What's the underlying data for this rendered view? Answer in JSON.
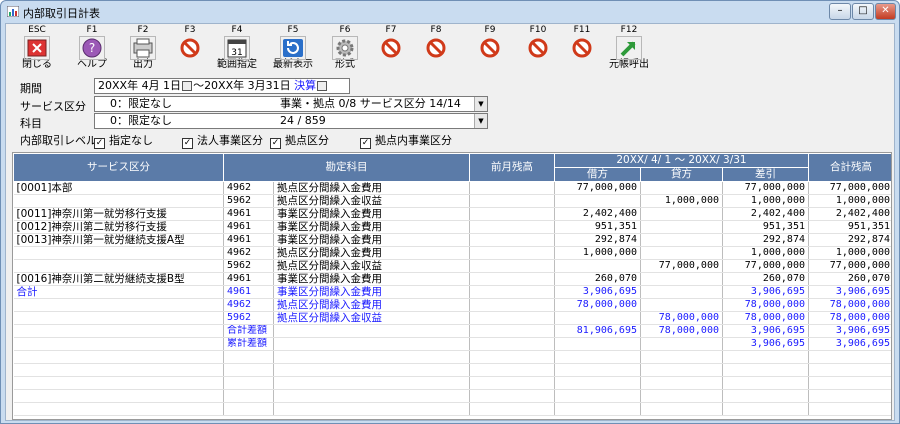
{
  "window": {
    "title": "内部取引日計表",
    "buttons": {
      "minimize": "–",
      "maximize": "□",
      "close": "✕"
    }
  },
  "toolbar": [
    {
      "key": "ESC",
      "label": "閉じる",
      "icon": "close-door-icon"
    },
    {
      "key": "F1",
      "label": "ヘルプ",
      "icon": "help-icon"
    },
    {
      "key": "F2",
      "label": "出力",
      "icon": "output-icon"
    },
    {
      "key": "F3",
      "label": "",
      "icon": "disabled-icon"
    },
    {
      "key": "F4",
      "label": "範囲指定",
      "icon": "calendar-icon"
    },
    {
      "key": "F5",
      "label": "最新表示",
      "icon": "refresh-icon"
    },
    {
      "key": "F6",
      "label": "形式",
      "icon": "gear-icon"
    },
    {
      "key": "F7",
      "label": "",
      "icon": "disabled-icon"
    },
    {
      "key": "F8",
      "label": "",
      "icon": "disabled-icon"
    },
    {
      "key": "F9",
      "label": "",
      "icon": "disabled-icon"
    },
    {
      "key": "F10",
      "label": "",
      "icon": "disabled-icon"
    },
    {
      "key": "F11",
      "label": "",
      "icon": "disabled-icon"
    },
    {
      "key": "F12",
      "label": "元帳呼出",
      "icon": "ledger-arrow-icon"
    }
  ],
  "form": {
    "period_label": "期間",
    "period_start": "20XX年 4月 1日",
    "period_sep": "～",
    "period_end": "20XX年 3月31日",
    "period_settle": "決算",
    "service_label": "サービス区分",
    "service_value": "0：限定なし",
    "service_summary": "事業・拠点 0/8  サービス区分 14/14",
    "subject_label": "科目",
    "subject_value": "0：限定なし",
    "subject_summary": "24 / 859",
    "level_label": "内部取引レベル",
    "checks": [
      {
        "label": "指定なし",
        "checked": true
      },
      {
        "label": "法人事業区分",
        "checked": true
      },
      {
        "label": "拠点区分",
        "checked": true
      },
      {
        "label": "拠点内事業区分",
        "checked": true
      }
    ]
  },
  "grid": {
    "headers": {
      "service": "サービス区分",
      "account": "勘定科目",
      "prev": "前月残高",
      "period": "20XX/ 4/ 1 ～ 20XX/ 3/31",
      "debit": "借方",
      "credit": "貸方",
      "diff": "差引",
      "total": "合計残高"
    },
    "rows": [
      {
        "service": "[0001]本部",
        "code": "4962",
        "account": "拠点区分間繰入金費用",
        "prev": "",
        "debit": "77,000,000",
        "credit": "",
        "diff": "77,000,000",
        "total": "77,000,000",
        "blue": false
      },
      {
        "service": "",
        "code": "5962",
        "account": "拠点区分間繰入金収益",
        "prev": "",
        "debit": "",
        "credit": "1,000,000",
        "diff": "1,000,000",
        "total": "1,000,000",
        "blue": false
      },
      {
        "service": "[0011]神奈川第一就労移行支援",
        "code": "4961",
        "account": "事業区分間繰入金費用",
        "prev": "",
        "debit": "2,402,400",
        "credit": "",
        "diff": "2,402,400",
        "total": "2,402,400",
        "blue": false
      },
      {
        "service": "[0012]神奈川第二就労移行支援",
        "code": "4961",
        "account": "事業区分間繰入金費用",
        "prev": "",
        "debit": "951,351",
        "credit": "",
        "diff": "951,351",
        "total": "951,351",
        "blue": false
      },
      {
        "service": "[0013]神奈川第一就労継続支援A型",
        "code": "4961",
        "account": "事業区分間繰入金費用",
        "prev": "",
        "debit": "292,874",
        "credit": "",
        "diff": "292,874",
        "total": "292,874",
        "blue": false
      },
      {
        "service": "",
        "code": "4962",
        "account": "拠点区分間繰入金費用",
        "prev": "",
        "debit": "1,000,000",
        "credit": "",
        "diff": "1,000,000",
        "total": "1,000,000",
        "blue": false
      },
      {
        "service": "",
        "code": "5962",
        "account": "拠点区分間繰入金収益",
        "prev": "",
        "debit": "",
        "credit": "77,000,000",
        "diff": "77,000,000",
        "total": "77,000,000",
        "blue": false
      },
      {
        "service": "[0016]神奈川第二就労継続支援B型",
        "code": "4961",
        "account": "事業区分間繰入金費用",
        "prev": "",
        "debit": "260,070",
        "credit": "",
        "diff": "260,070",
        "total": "260,070",
        "blue": false
      },
      {
        "service": "合計",
        "code": "4961",
        "account": "事業区分間繰入金費用",
        "prev": "",
        "debit": "3,906,695",
        "credit": "",
        "diff": "3,906,695",
        "total": "3,906,695",
        "blue": true
      },
      {
        "service": "",
        "code": "4962",
        "account": "拠点区分間繰入金費用",
        "prev": "",
        "debit": "78,000,000",
        "credit": "",
        "diff": "78,000,000",
        "total": "78,000,000",
        "blue": true
      },
      {
        "service": "",
        "code": "5962",
        "account": "拠点区分間繰入金収益",
        "prev": "",
        "debit": "",
        "credit": "78,000,000",
        "diff": "78,000,000",
        "total": "78,000,000",
        "blue": true
      },
      {
        "service": "",
        "code": "合計差額",
        "account": "",
        "prev": "",
        "debit": "81,906,695",
        "credit": "78,000,000",
        "diff": "3,906,695",
        "total": "3,906,695",
        "blue": true
      },
      {
        "service": "",
        "code": "累計差額",
        "account": "",
        "prev": "",
        "debit": "",
        "credit": "",
        "diff": "3,906,695",
        "total": "3,906,695",
        "blue": true
      },
      {
        "service": "",
        "code": "",
        "account": "",
        "prev": "",
        "debit": "",
        "credit": "",
        "diff": "",
        "total": "",
        "blue": false
      },
      {
        "service": "",
        "code": "",
        "account": "",
        "prev": "",
        "debit": "",
        "credit": "",
        "diff": "",
        "total": "",
        "blue": false
      },
      {
        "service": "",
        "code": "",
        "account": "",
        "prev": "",
        "debit": "",
        "credit": "",
        "diff": "",
        "total": "",
        "blue": false
      },
      {
        "service": "",
        "code": "",
        "account": "",
        "prev": "",
        "debit": "",
        "credit": "",
        "diff": "",
        "total": "",
        "blue": false
      },
      {
        "service": "",
        "code": "",
        "account": "",
        "prev": "",
        "debit": "",
        "credit": "",
        "diff": "",
        "total": "",
        "blue": false
      }
    ]
  }
}
